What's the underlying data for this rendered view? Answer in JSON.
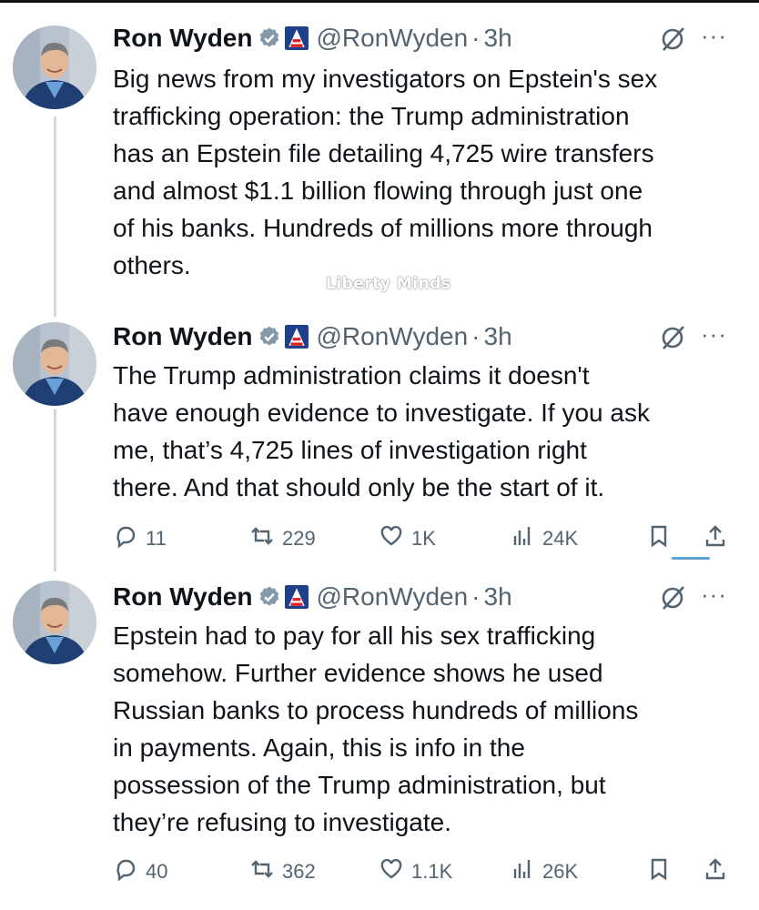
{
  "colors": {
    "text": "#0f1419",
    "muted": "#536471",
    "verified": "#829aab",
    "thread_line": "#cfd9de"
  },
  "watermark": "Liberty Minds",
  "tweets": [
    {
      "name": "Ron Wyden",
      "handle": "@RonWyden",
      "separator": "·",
      "time": "3h",
      "text": "Big news from my investigators on Epstein's sex\ntrafficking operation: the Trump administration\nhas an Epstein file detailing 4,725 wire transfers\nand almost $1.1 billion flowing through just one\nof his banks. Hundreds of millions more through\nothers.",
      "more": "···"
    },
    {
      "name": "Ron Wyden",
      "handle": "@RonWyden",
      "separator": "·",
      "time": "3h",
      "text": "The Trump administration claims it doesn't\nhave enough evidence to investigate. If you ask\nme, that’s 4,725 lines of investigation right\nthere. And that should only be the start of it.",
      "more": "···",
      "replies": "11",
      "reposts": "229",
      "likes": "1K",
      "views": "24K"
    },
    {
      "name": "Ron Wyden",
      "handle": "@RonWyden",
      "separator": "·",
      "time": "3h",
      "text": "Epstein had to pay for all his sex trafficking\nsomehow. Further evidence shows he used\nRussian banks to process hundreds of millions\nin payments. Again, this is info in the\npossession of the Trump administration, but\nthey’re refusing to investigate.",
      "more": "···",
      "replies": "40",
      "reposts": "362",
      "likes": "1.1K",
      "views": "26K"
    }
  ],
  "icons": {
    "verified": "verified-badge-icon",
    "flag": "government-flag-icon",
    "grok": "grok-icon",
    "reply": "reply-icon",
    "repost": "repost-icon",
    "like": "heart-icon",
    "views": "views-icon",
    "bookmark": "bookmark-icon",
    "share": "share-icon"
  }
}
